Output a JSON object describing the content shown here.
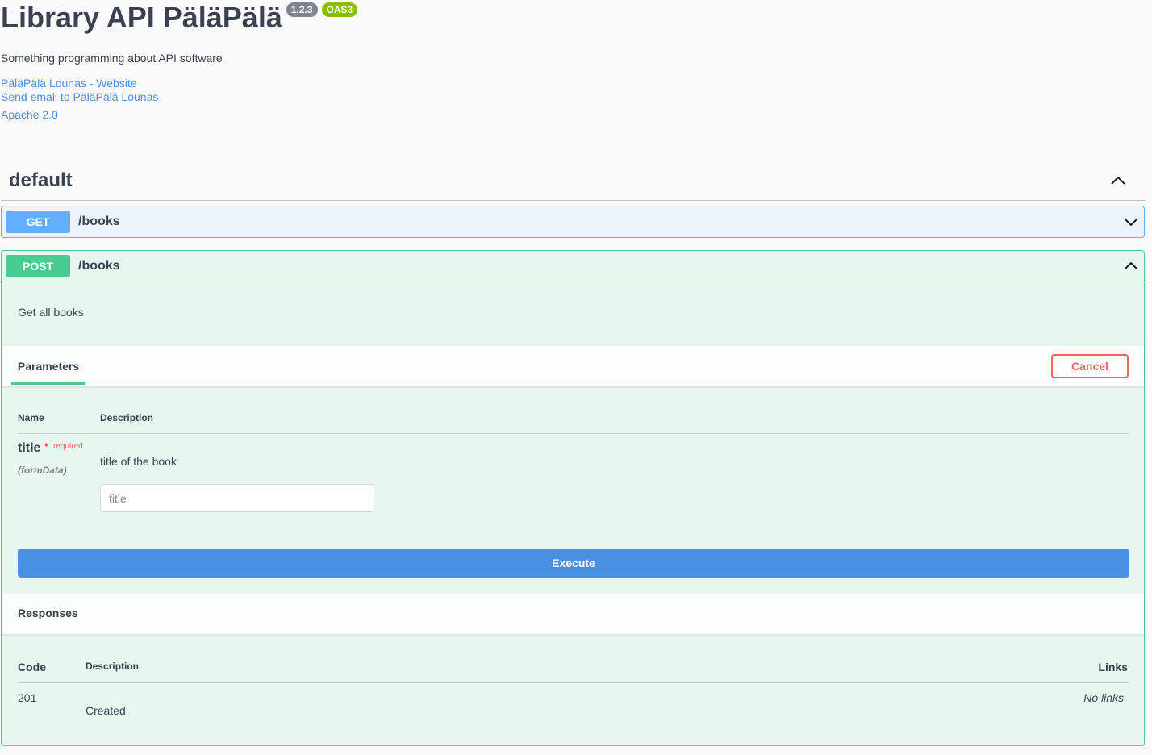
{
  "info": {
    "title": "Library API PäläPälä",
    "version": "1.2.3",
    "oas": "OAS3",
    "description": "Something programming about API software",
    "links": {
      "website": "PäläPälä Lounas - Website",
      "email": "Send email to PäläPälä Lounas",
      "license": "Apache 2.0"
    }
  },
  "section": {
    "title": "default"
  },
  "operations": [
    {
      "method": "GET",
      "path": "/books"
    },
    {
      "method": "POST",
      "path": "/books",
      "description": "Get all books"
    }
  ],
  "parameters": {
    "tab_label": "Parameters",
    "cancel_label": "Cancel",
    "header_name": "Name",
    "header_description": "Description",
    "items": [
      {
        "name": "title",
        "star": "*",
        "required": "required",
        "in": "(formData)",
        "description": "title of the book",
        "placeholder": "title"
      }
    ],
    "execute_label": "Execute"
  },
  "responses": {
    "title": "Responses",
    "header_code": "Code",
    "header_description": "Description",
    "header_links": "Links",
    "items": [
      {
        "code": "201",
        "description": "Created",
        "links": "No links"
      }
    ]
  },
  "colors": {
    "get": "#61affe",
    "post": "#49cc90",
    "cancel": "#ff6060",
    "execute": "#4990e2",
    "link": "#4990e2"
  }
}
